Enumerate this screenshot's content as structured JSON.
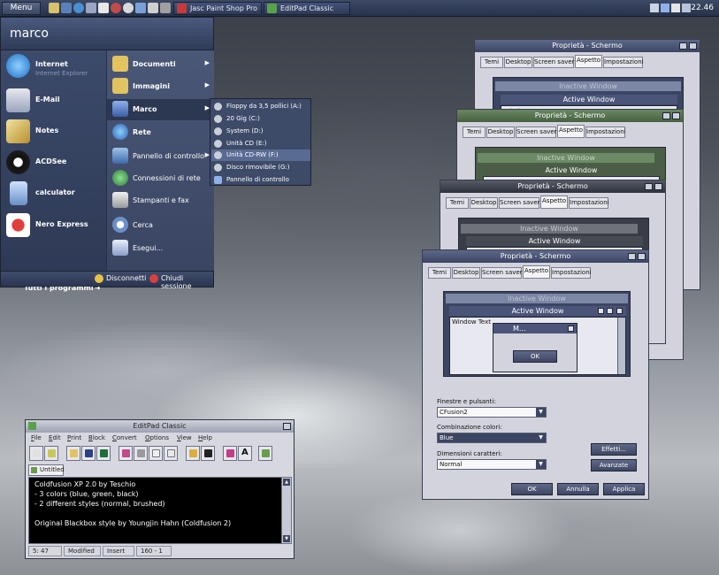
{
  "taskbar": {
    "menu_label": "Menu",
    "tasks": [
      {
        "label": "Jasc Paint Shop Pro"
      },
      {
        "label": "EditPad Classic"
      }
    ],
    "clock": "22.46"
  },
  "start_menu": {
    "user": "marco",
    "pinned": [
      {
        "label": "Internet",
        "sub": "Internet Explorer"
      },
      {
        "label": "E-Mail",
        "sub": ""
      },
      {
        "label": "Notes",
        "sub": ""
      },
      {
        "label": "ACDSee",
        "sub": ""
      },
      {
        "label": "calculator",
        "sub": ""
      },
      {
        "label": "Nero Express",
        "sub": ""
      }
    ],
    "all_programs": "Tutti i programmi",
    "places": [
      {
        "label": "Documenti"
      },
      {
        "label": "Immagini"
      },
      {
        "label": "Marco"
      },
      {
        "label": "Rete"
      },
      {
        "label": "Pannello di controllo"
      },
      {
        "label": "Connessioni di rete"
      },
      {
        "label": "Stampanti e fax"
      },
      {
        "label": "Cerca"
      },
      {
        "label": "Esegui..."
      }
    ],
    "logoff": "Disconnetti",
    "shutdown": "Chiudi sessione"
  },
  "submenu": {
    "items": [
      {
        "label": "Floppy da 3,5 pollici (A:)"
      },
      {
        "label": "20 Gig (C:)"
      },
      {
        "label": "System (D:)"
      },
      {
        "label": "Unità CD (E:)"
      },
      {
        "label": "Unità CD-RW (F:)"
      },
      {
        "label": "Disco rimovibile (G:)"
      },
      {
        "label": "Pannello di controllo"
      }
    ]
  },
  "display_props": {
    "title": "Proprietà - Schermo",
    "tabs": [
      "Temi",
      "Desktop",
      "Screen saver",
      "Aspetto",
      "Impostazioni"
    ],
    "inactive_window": "Inactive Window",
    "active_window": "Active Window",
    "window_text": "Window Text",
    "message_title": "M...",
    "ok_small": "OK",
    "windows_buttons_label": "Finestre e pulsanti:",
    "windows_buttons_value": "CFusion2",
    "color_scheme_label": "Combinazione colori:",
    "color_scheme_value": "Blue",
    "font_size_label": "Dimensioni caratteri:",
    "font_size_value": "Normal",
    "effects_button": "Effetti...",
    "advanced_button": "Avanzate",
    "ok_button": "OK",
    "cancel_button": "Annulla",
    "apply_button": "Applica"
  },
  "editpad": {
    "title": "EditPad Classic",
    "menu": [
      "File",
      "Edit",
      "Print",
      "Block",
      "Convert",
      "Options",
      "View",
      "Help"
    ],
    "tab": "Untitled",
    "lines": [
      "Coldfusion XP 2.0 by Teschio",
      "- 3 colors (blue, green, black)",
      "- 2 different styles (normal, brushed)",
      "",
      "Original Blackbox style by Youngjin Hahn (Coldfusion 2)"
    ],
    "status": [
      "5: 47",
      "Modified",
      "Insert",
      "160 - 1"
    ]
  },
  "colors": {
    "accent_blue": "#3c4563",
    "accent_green": "#46613f",
    "dialog_bg": "#d2d3dc"
  }
}
